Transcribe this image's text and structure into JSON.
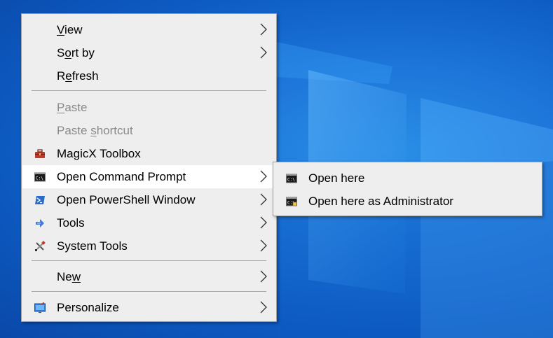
{
  "desktop": {
    "background": "#1c74d8"
  },
  "context_menu": {
    "items": [
      {
        "pre": "",
        "ul": "V",
        "post": "iew",
        "submenu": true,
        "disabled": false
      },
      {
        "pre": "S",
        "ul": "o",
        "post": "rt by",
        "submenu": true,
        "disabled": false
      },
      {
        "pre": "R",
        "ul": "e",
        "post": "fresh",
        "submenu": false,
        "disabled": false
      },
      {
        "pre": "",
        "ul": "P",
        "post": "aste",
        "submenu": false,
        "disabled": true
      },
      {
        "pre": "Paste ",
        "ul": "s",
        "post": "hortcut",
        "submenu": false,
        "disabled": true
      },
      {
        "label": "MagicX Toolbox",
        "icon": "toolbox-icon",
        "submenu": false
      },
      {
        "label": "Open Command Prompt",
        "icon": "command-prompt-icon",
        "submenu": true,
        "highlighted": true
      },
      {
        "label": "Open PowerShell Window",
        "icon": "powershell-icon",
        "submenu": true
      },
      {
        "label": "Tools",
        "icon": "tools-arrow-icon",
        "submenu": true
      },
      {
        "label": "System Tools",
        "icon": "system-tools-icon",
        "submenu": true
      },
      {
        "pre": "Ne",
        "ul": "w",
        "post": "",
        "submenu": true
      },
      {
        "label": "Personalize",
        "icon": "personalize-icon",
        "submenu": true
      }
    ]
  },
  "submenu": {
    "items": [
      {
        "label": "Open here",
        "icon": "command-prompt-icon"
      },
      {
        "label": "Open here as Administrator",
        "icon": "command-prompt-admin-icon"
      }
    ]
  }
}
